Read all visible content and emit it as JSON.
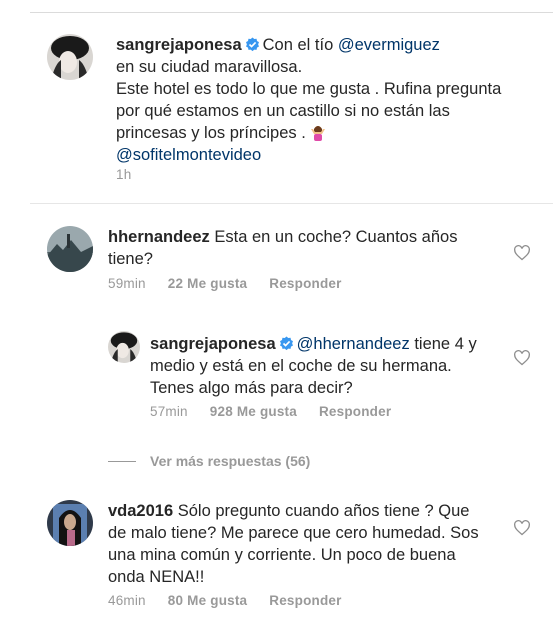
{
  "post": {
    "username": "sangrejaponesa",
    "text_a": "Con el tío",
    "mention_a": "@evermiguez",
    "text_b": "en su ciudad maravillosa.",
    "text_c": "Este hotel es todo lo que me gusta . Rufina pregunta por qué estamos en un castillo si no están las princesas y los príncipes .",
    "mention_b": "@sofitelmontevideo",
    "time": "1h"
  },
  "comments": [
    {
      "username": "hhernandeez",
      "text": "Esta en un coche? Cuantos años tiene?",
      "time": "59min",
      "likes": "22 Me gusta",
      "reply": "Responder"
    },
    {
      "username": "sangrejaponesa",
      "mention": "@hhernandeez",
      "text": "tiene 4 y medio y está en el coche de su hermana. Tenes algo más para decir?",
      "time": "57min",
      "likes": "928 Me gusta",
      "reply": "Responder"
    },
    {
      "username": "vda2016",
      "text": "Sólo pregunto cuando años tiene ? Que de malo tiene? Me parece que cero humedad.  Sos una mina común y corriente. Un poco de buena onda NENA!!",
      "time": "46min",
      "likes": "80 Me gusta",
      "reply": "Responder"
    }
  ],
  "view_more": "Ver más respuestas (56)",
  "colors": {
    "username": "#262626",
    "mention": "#003569",
    "meta": "#999999",
    "verified": "#3897f0",
    "divider": "#dbdbdb"
  },
  "icons": [
    "verified-badge-icon",
    "heart-outline-icon",
    "woman-shrugging-emoji"
  ]
}
